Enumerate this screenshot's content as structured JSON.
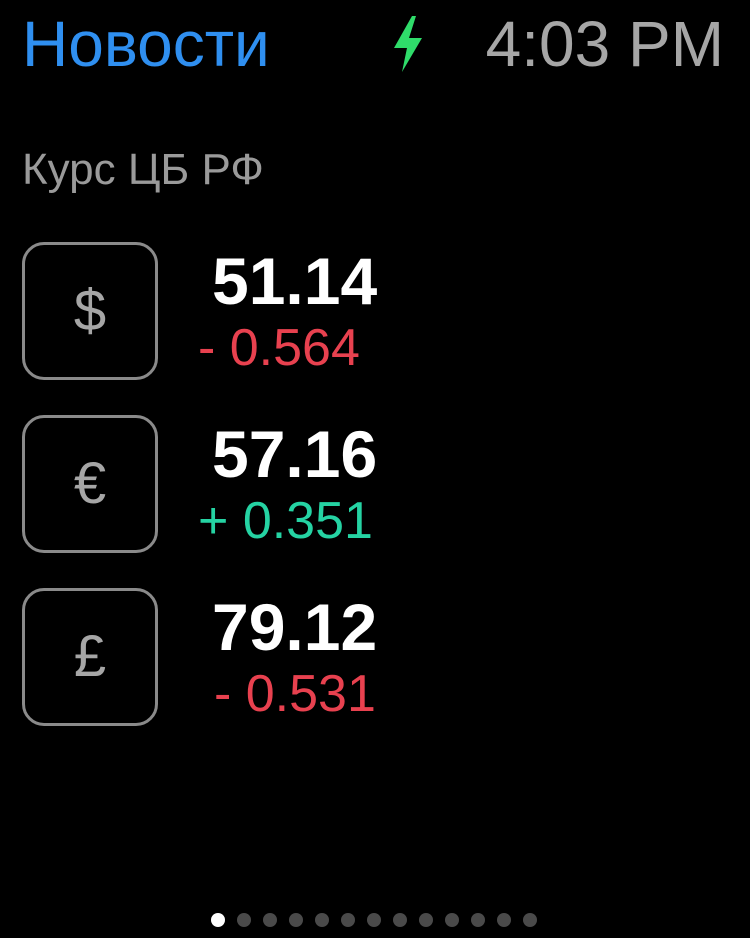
{
  "status_bar": {
    "back_label": "Новости",
    "time": "4:03 PM",
    "charge_icon": "charging-bolt-icon",
    "charge_color": "#2fdc6a"
  },
  "section_title": "Курс ЦБ РФ",
  "rates": [
    {
      "symbol": "$",
      "icon": "dollar-icon",
      "value": "51.14",
      "change": "- 0.564",
      "direction": "down"
    },
    {
      "symbol": "€",
      "icon": "euro-icon",
      "value": "57.16",
      "change": "+ 0.351",
      "direction": "up"
    },
    {
      "symbol": "£",
      "icon": "pound-icon",
      "value": "79.12",
      "change": "- 0.531",
      "direction": "down"
    }
  ],
  "colors": {
    "accent": "#2f8ff0",
    "down": "#e8414f",
    "up": "#25d3a3"
  },
  "pagination": {
    "total_pages": 13,
    "current_page": 1
  }
}
